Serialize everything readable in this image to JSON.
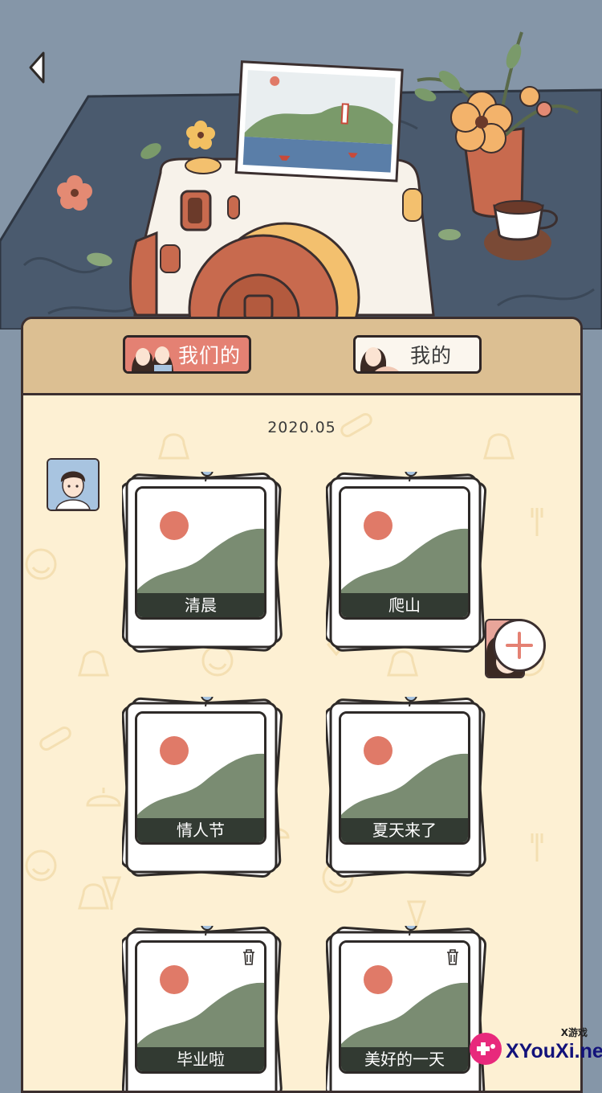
{
  "nav": {
    "back_icon": "chevron-left-icon"
  },
  "tabs": [
    {
      "label": "我们的",
      "active": true,
      "avatar": "couple-avatar"
    },
    {
      "label": "我的",
      "active": false,
      "avatar": "girl-avatar"
    }
  ],
  "album": {
    "date": "2020.05",
    "cards": [
      {
        "title": "清晨",
        "deletable": false
      },
      {
        "title": "爬山",
        "deletable": false
      },
      {
        "title": "情人节",
        "deletable": false
      },
      {
        "title": "夏天来了",
        "deletable": false
      },
      {
        "title": "毕业啦",
        "deletable": true
      },
      {
        "title": "美好的一天",
        "deletable": true
      }
    ]
  },
  "add_button": {
    "icon": "plus-icon"
  },
  "watermark": {
    "small": "X游戏",
    "text": "XYouXi.net"
  },
  "colors": {
    "wall": "#8596a8",
    "table": "#4a5a6e",
    "panel": "#fdf0d3",
    "header": "#dcbf92",
    "active_tab": "#e48173",
    "caption": "#323a32",
    "photo_sun": "#e07a68",
    "photo_hill": "#7a8c72"
  }
}
